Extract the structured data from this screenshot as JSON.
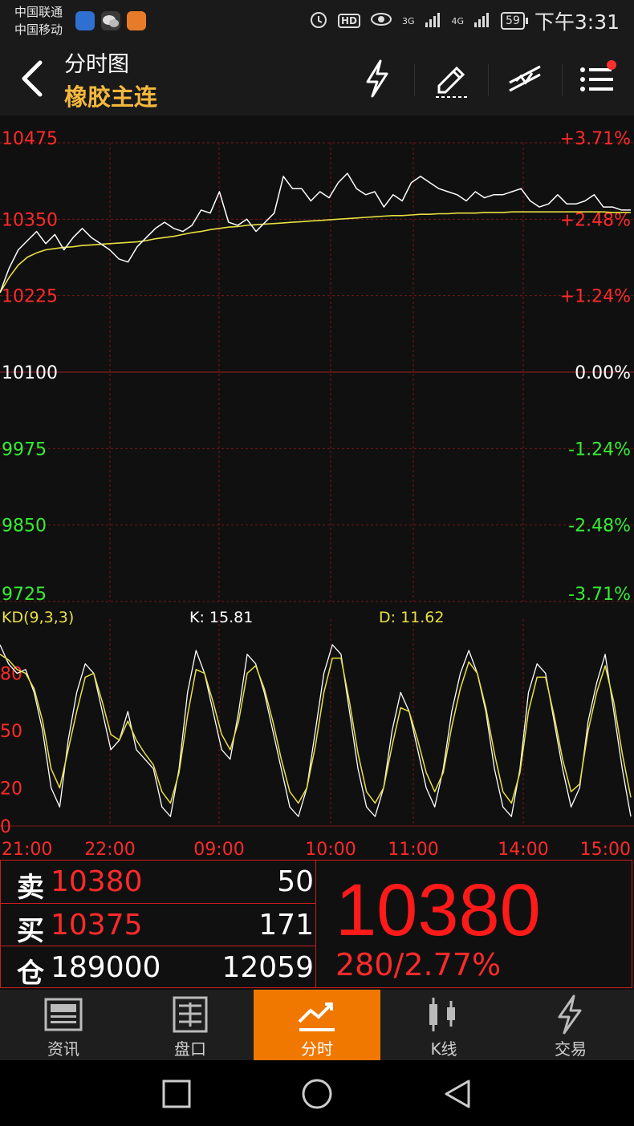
{
  "status": {
    "carrier1": "中国联通",
    "carrier2": "中国移动",
    "network1": "3G",
    "network2": "4G",
    "battery": "59",
    "time": "下午3:31"
  },
  "header": {
    "title": "分时图",
    "subtitle": "橡胶主连"
  },
  "price_chart": {
    "left_ticks": [
      "10475",
      "10350",
      "10225",
      "10100",
      "9975",
      "9850",
      "9725"
    ],
    "right_ticks": [
      "+3.71%",
      "+2.48%",
      "+1.24%",
      "0.00%",
      "-1.24%",
      "-2.48%",
      "-3.71%"
    ],
    "tick_colors": [
      "#ff2a2a",
      "#ff2a2a",
      "#ff2a2a",
      "#ffffff",
      "#33ee33",
      "#33ee33",
      "#33ee33"
    ],
    "ylim": [
      9725,
      10475
    ],
    "price_series": [
      10230,
      10270,
      10300,
      10315,
      10330,
      10310,
      10325,
      10300,
      10320,
      10335,
      10320,
      10310,
      10300,
      10285,
      10280,
      10305,
      10320,
      10335,
      10345,
      10335,
      10330,
      10340,
      10365,
      10360,
      10395,
      10345,
      10340,
      10350,
      10330,
      10345,
      10360,
      10420,
      10400,
      10400,
      10380,
      10395,
      10385,
      10410,
      10425,
      10400,
      10390,
      10395,
      10370,
      10390,
      10380,
      10410,
      10420,
      10410,
      10400,
      10395,
      10390,
      10380,
      10395,
      10385,
      10390,
      10390,
      10395,
      10400,
      10380,
      10370,
      10375,
      10390,
      10375,
      10375,
      10380,
      10390,
      10370,
      10370,
      10365,
      10365
    ],
    "avg_series": [
      10230,
      10255,
      10275,
      10288,
      10295,
      10300,
      10302,
      10304,
      10305,
      10307,
      10308,
      10309,
      10310,
      10311,
      10312,
      10313,
      10315,
      10318,
      10320,
      10322,
      10325,
      10328,
      10330,
      10333,
      10335,
      10337,
      10338,
      10340,
      10341,
      10342,
      10343,
      10344,
      10345,
      10346,
      10347,
      10348,
      10349,
      10350,
      10351,
      10352,
      10353,
      10354,
      10355,
      10356,
      10356,
      10357,
      10358,
      10358,
      10359,
      10359,
      10360,
      10360,
      10360,
      10361,
      10361,
      10361,
      10362,
      10362,
      10362,
      10362,
      10362,
      10362,
      10362,
      10362,
      10362,
      10362,
      10362,
      10361,
      10361,
      10361
    ]
  },
  "kd": {
    "label": "KD(9,3,3)",
    "k_value": "K: 15.81",
    "d_value": "D: 11.62",
    "y_ticks": [
      "80",
      "50",
      "20",
      "0"
    ],
    "ylim": [
      0,
      100
    ],
    "k_series": [
      95,
      85,
      80,
      82,
      70,
      50,
      20,
      10,
      45,
      70,
      85,
      80,
      60,
      40,
      45,
      60,
      40,
      35,
      30,
      10,
      5,
      30,
      70,
      92,
      80,
      60,
      40,
      35,
      60,
      90,
      85,
      70,
      50,
      30,
      10,
      5,
      20,
      50,
      80,
      95,
      90,
      60,
      30,
      10,
      5,
      20,
      50,
      70,
      60,
      40,
      20,
      10,
      30,
      60,
      80,
      92,
      80,
      60,
      30,
      10,
      5,
      30,
      70,
      85,
      80,
      55,
      30,
      10,
      20,
      55,
      75,
      90,
      60,
      30,
      5
    ],
    "d_series": [
      90,
      87,
      82,
      80,
      72,
      55,
      30,
      20,
      40,
      60,
      78,
      80,
      65,
      48,
      45,
      55,
      45,
      38,
      32,
      18,
      12,
      28,
      58,
      82,
      80,
      65,
      48,
      40,
      55,
      80,
      84,
      72,
      55,
      35,
      18,
      12,
      20,
      42,
      70,
      88,
      88,
      65,
      38,
      18,
      12,
      20,
      42,
      62,
      60,
      45,
      28,
      18,
      28,
      52,
      72,
      86,
      80,
      62,
      38,
      18,
      12,
      28,
      60,
      78,
      78,
      58,
      35,
      18,
      22,
      50,
      70,
      84,
      65,
      38,
      15
    ]
  },
  "time_axis": [
    "21:00",
    "22:00",
    "09:00",
    "10:00",
    "11:00",
    "14:00",
    "15:00"
  ],
  "quote": {
    "sell_label": "卖",
    "sell_price": "10380",
    "sell_vol": "50",
    "buy_label": "买",
    "buy_price": "10375",
    "buy_vol": "171",
    "oi_label": "仓",
    "oi_value": "189000",
    "oi_vol": "12059",
    "last_price": "10380",
    "change": "280/2.77%"
  },
  "tabs": [
    {
      "label": "资讯"
    },
    {
      "label": "盘口"
    },
    {
      "label": "分时"
    },
    {
      "label": "K线"
    },
    {
      "label": "交易"
    }
  ],
  "colors": {
    "up": "#ff2a2a",
    "down": "#33ee33",
    "avg_line": "#e8e040",
    "accent": "#f07800",
    "subtitle": "#f5b83d"
  }
}
